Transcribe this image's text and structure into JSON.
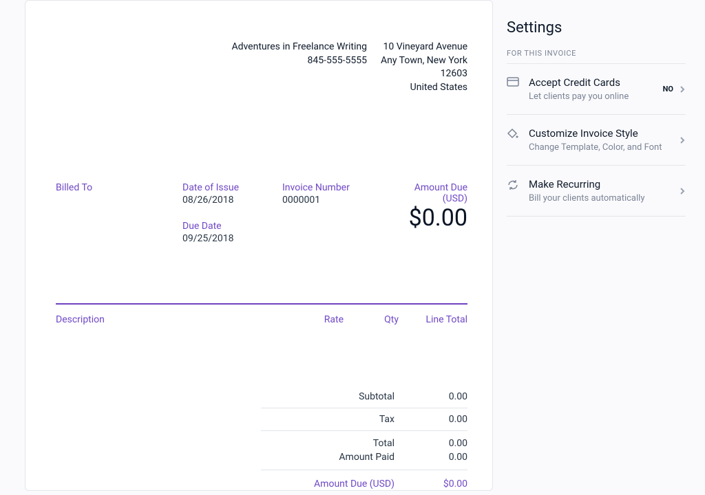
{
  "company": {
    "name": "Adventures in Freelance Writing",
    "phone": "845-555-5555"
  },
  "address": {
    "line1": "10 Vineyard Avenue",
    "line2": "Any Town, New York",
    "zip": "12603",
    "country": "United States"
  },
  "meta": {
    "billed_to_label": "Billed To",
    "date_of_issue_label": "Date of Issue",
    "date_of_issue": "08/26/2018",
    "due_date_label": "Due Date",
    "due_date": "09/25/2018",
    "invoice_number_label": "Invoice Number",
    "invoice_number": "0000001",
    "amount_due_label": "Amount Due (USD)",
    "amount_due_big": "$0.00"
  },
  "items_header": {
    "description": "Description",
    "rate": "Rate",
    "qty": "Qty",
    "line_total": "Line Total"
  },
  "totals": {
    "subtotal_label": "Subtotal",
    "subtotal": "0.00",
    "tax_label": "Tax",
    "tax": "0.00",
    "total_label": "Total",
    "total": "0.00",
    "amount_paid_label": "Amount Paid",
    "amount_paid": "0.00",
    "amount_due_label": "Amount Due (USD)",
    "amount_due": "$0.00"
  },
  "settings": {
    "title": "Settings",
    "subtitle": "FOR THIS INVOICE",
    "items": [
      {
        "title": "Accept Credit Cards",
        "desc": "Let clients pay you online",
        "badge": "NO"
      },
      {
        "title": "Customize Invoice Style",
        "desc": "Change Template, Color, and Font",
        "badge": ""
      },
      {
        "title": "Make Recurring",
        "desc": "Bill your clients automatically",
        "badge": ""
      }
    ]
  }
}
